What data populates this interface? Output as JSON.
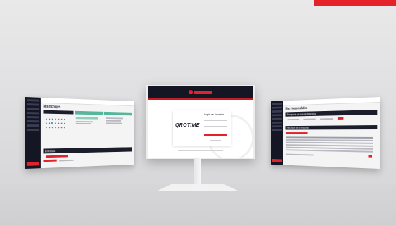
{
  "left_screen": {
    "title": "Mis fichajes",
    "section": "Entradas"
  },
  "center_screen": {
    "brand": "QROTIME",
    "login_title": "Login de Usuarios"
  },
  "right_screen": {
    "title": "Días incumplidos",
    "section_filter": "Búsqueda de incumplimientos",
    "section_results": "Resultado de la búsqueda"
  }
}
